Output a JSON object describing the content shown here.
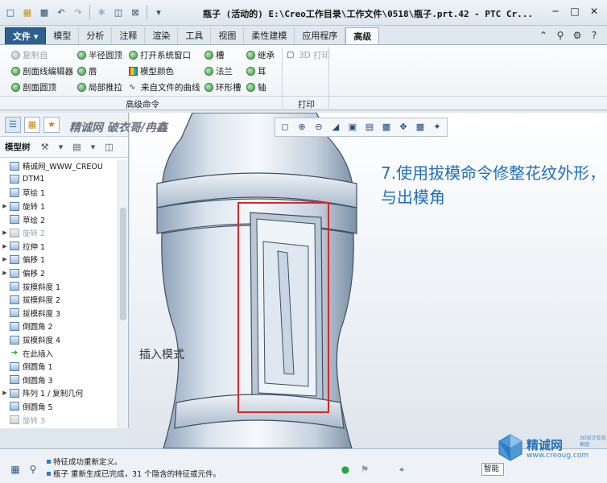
{
  "window": {
    "title": "瓶子 (活动的) E:\\Creo工作目录\\工作文件\\0518\\瓶子.prt.42 - PTC Cr...",
    "minimize_icon": "minimize-icon",
    "maximize_icon": "maximize-icon",
    "close_icon": "close-icon"
  },
  "quick_access": {
    "icons": [
      "new-icon",
      "open-icon",
      "save-icon",
      "undo-icon",
      "redo-icon",
      "regenerate-icon",
      "windows-icon",
      "close-window-icon",
      "customize-icon"
    ]
  },
  "ribbon": {
    "file_label": "文件",
    "tabs": [
      "模型",
      "分析",
      "注释",
      "渲染",
      "工具",
      "视图",
      "柔性建模",
      "应用程序",
      "高级"
    ],
    "active_tab": "高级",
    "right_icons": [
      "minimize-ribbon-icon",
      "search-icon",
      "settings-icon",
      "help-icon"
    ],
    "items": {
      "copy_from": "复制自",
      "radius_dome": "半径圆顶",
      "open_system_window": "打开系统窗口",
      "groove": "槽",
      "inherit": "继承",
      "print_3d": "3D 打印",
      "section_editor": "剖面线编辑器",
      "lip": "唇",
      "model_color": "模型颜色",
      "flange": "法兰",
      "ear": "耳",
      "section_dome": "剖面圆顶",
      "local_push": "局部推拉",
      "curve_from_file": "来自文件的曲线",
      "toroidal_bend": "环形槽",
      "shaft": "轴"
    },
    "groups": {
      "advanced_commands": "高级命令",
      "print": "打印"
    }
  },
  "model_tree": {
    "title": "模型树",
    "watermark": "精诚网 破衣哥/冉鑫",
    "items": [
      {
        "label": "精诚网_WWW_CREOU",
        "state": "normal",
        "expand": false
      },
      {
        "label": "DTM1",
        "state": "normal",
        "expand": false
      },
      {
        "label": "草绘 1",
        "state": "normal",
        "expand": false
      },
      {
        "label": "旋转 1",
        "state": "normal",
        "expand": true
      },
      {
        "label": "草绘 2",
        "state": "normal",
        "expand": false
      },
      {
        "label": "旋转 2",
        "state": "disabled",
        "expand": true
      },
      {
        "label": "拉伸 1",
        "state": "normal",
        "expand": true
      },
      {
        "label": "偏移 1",
        "state": "normal",
        "expand": true
      },
      {
        "label": "偏移 2",
        "state": "normal",
        "expand": true
      },
      {
        "label": "拔模斜度 1",
        "state": "normal",
        "expand": false
      },
      {
        "label": "拔模斜度 2",
        "state": "normal",
        "expand": false
      },
      {
        "label": "拔模斜度 3",
        "state": "normal",
        "expand": false
      },
      {
        "label": "倒圆角 2",
        "state": "normal",
        "expand": false
      },
      {
        "label": "拔模斜度 4",
        "state": "normal",
        "expand": false
      },
      {
        "label": "在此插入",
        "state": "insert",
        "expand": false
      },
      {
        "label": "倒圆角 1",
        "state": "normal",
        "expand": false
      },
      {
        "label": "倒圆角 3",
        "state": "normal",
        "expand": false
      },
      {
        "label": "阵列 1 / 复制几何",
        "state": "normal",
        "expand": true
      },
      {
        "label": "倒圆角 5",
        "state": "normal",
        "expand": false
      },
      {
        "label": "旋转 3",
        "state": "disabled",
        "expand": false
      }
    ]
  },
  "graphics": {
    "annotation": "7.使用拔模命令修整花纹外形，与出模角",
    "mode_label": "插入模式",
    "highlight_color": "#d42a2a"
  },
  "status": {
    "messages": [
      "特征成功重新定义。",
      "瓶子 重新生成已完成，31 个隐含的特征或元件。"
    ],
    "filter": "智能"
  },
  "logo": {
    "name": "精诚网",
    "url": "www.creoug.com",
    "tag": "3D设计交流家园"
  }
}
